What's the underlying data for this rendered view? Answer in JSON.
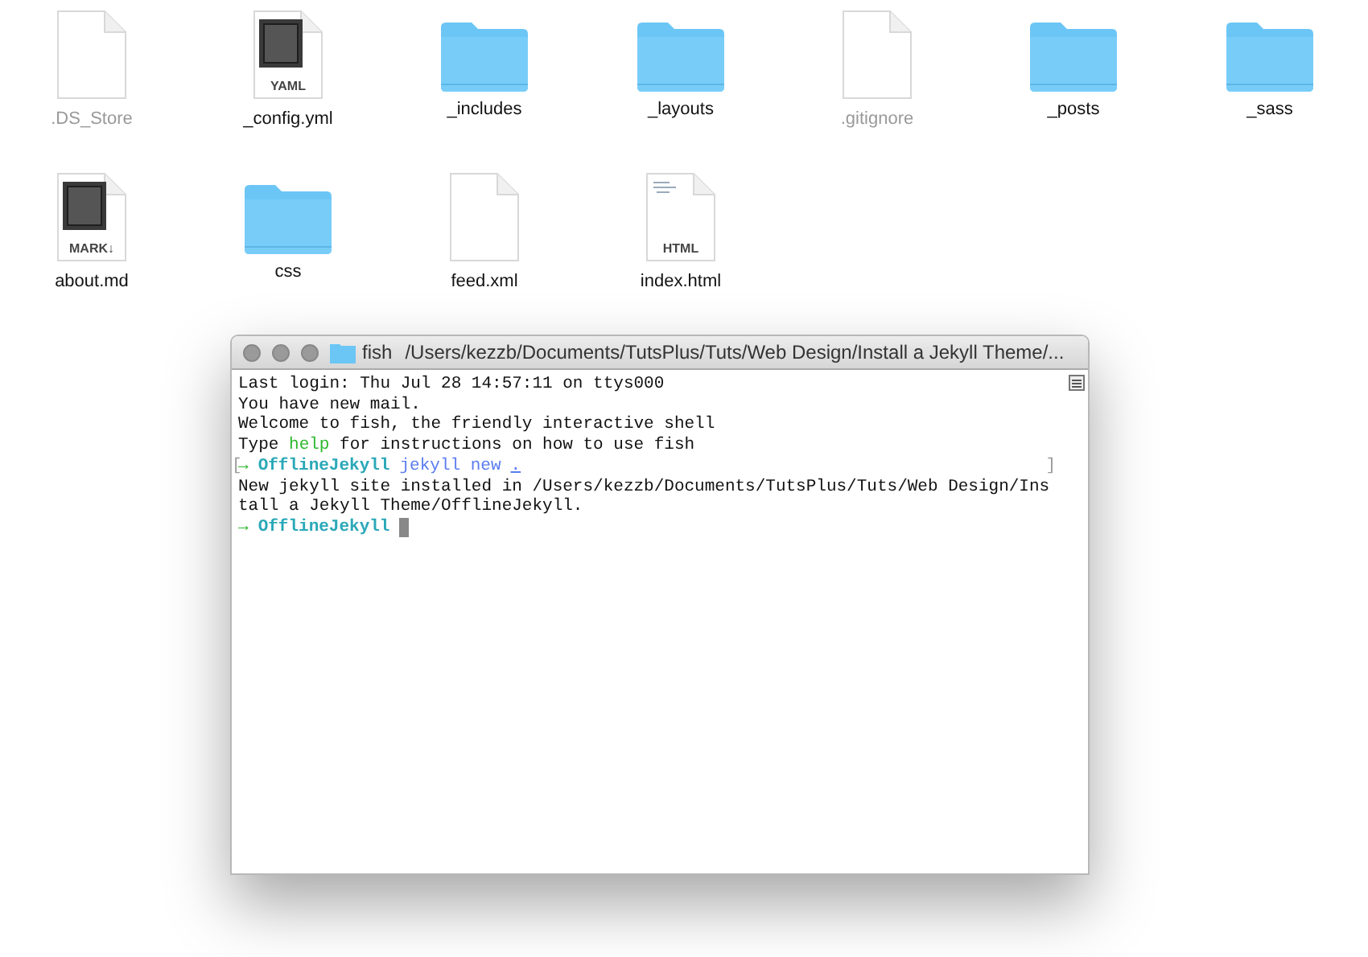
{
  "files": [
    {
      "name": ".DS_Store",
      "kind": "blank",
      "hidden": true
    },
    {
      "name": "_config.yml",
      "kind": "badge",
      "badge": "YAML",
      "hidden": false
    },
    {
      "name": "_includes",
      "kind": "folder",
      "hidden": false
    },
    {
      "name": "_layouts",
      "kind": "folder",
      "hidden": false
    },
    {
      "name": ".gitignore",
      "kind": "blank",
      "hidden": true
    },
    {
      "name": "_posts",
      "kind": "folder",
      "hidden": false
    },
    {
      "name": "_sass",
      "kind": "folder",
      "hidden": false
    },
    {
      "name": "about.md",
      "kind": "badge",
      "badge": "MARK↓",
      "hidden": false
    },
    {
      "name": "css",
      "kind": "folder",
      "hidden": false
    },
    {
      "name": "feed.xml",
      "kind": "blank",
      "hidden": false
    },
    {
      "name": "index.html",
      "kind": "doc",
      "badge": "HTML",
      "hidden": false
    }
  ],
  "terminal": {
    "title": "fish",
    "path": "/Users/kezzb/Documents/TutsPlus/Tuts/Web Design/Install a Jekyll Theme/...",
    "lines": [
      {
        "segments": [
          {
            "kind": "plain",
            "text": "Last login: Thu Jul 28 14:57:11 on ttys000"
          }
        ]
      },
      {
        "segments": [
          {
            "kind": "plain",
            "text": "You have new mail."
          }
        ]
      },
      {
        "segments": [
          {
            "kind": "plain",
            "text": "Welcome to fish, the friendly interactive shell"
          }
        ]
      },
      {
        "segments": [
          {
            "kind": "plain",
            "text": "Type "
          },
          {
            "kind": "help",
            "text": "help"
          },
          {
            "kind": "plain",
            "text": " for instructions on how to use fish"
          }
        ]
      },
      {
        "mark_left": "[",
        "mark_right": "]",
        "segments": [
          {
            "kind": "arrow",
            "text": "→"
          },
          {
            "kind": "dir",
            "text": "OfflineJekyll"
          },
          {
            "kind": "command",
            "text": "jekyll new"
          },
          {
            "kind": "arg",
            "text": "."
          }
        ]
      },
      {
        "segments": [
          {
            "kind": "plain",
            "text": "New jekyll site installed in /Users/kezzb/Documents/TutsPlus/Tuts/Web Design/Ins"
          }
        ]
      },
      {
        "segments": [
          {
            "kind": "plain",
            "text": "tall a Jekyll Theme/OfflineJekyll."
          }
        ]
      },
      {
        "cursor": true,
        "segments": [
          {
            "kind": "arrow",
            "text": "→"
          },
          {
            "kind": "dir",
            "text": "OfflineJekyll"
          }
        ]
      }
    ]
  }
}
